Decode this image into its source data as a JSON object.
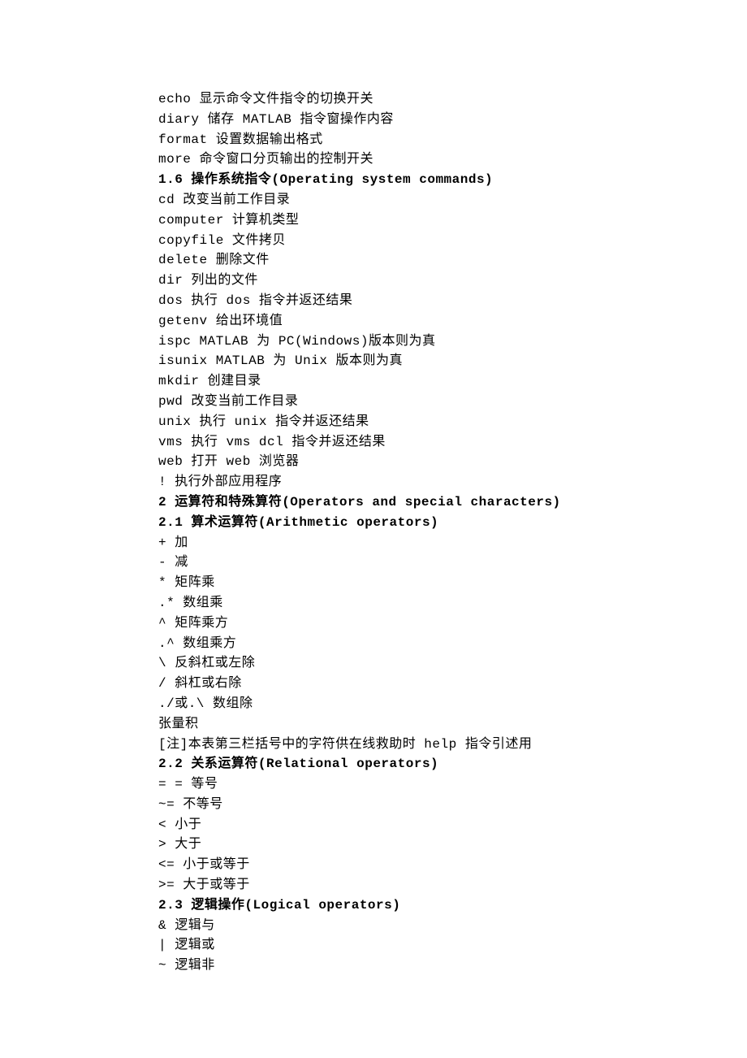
{
  "lines": [
    {
      "text": "echo 显示命令文件指令的切换开关",
      "heading": false
    },
    {
      "text": "diary 储存 MATLAB 指令窗操作内容",
      "heading": false
    },
    {
      "text": "format 设置数据输出格式",
      "heading": false
    },
    {
      "text": "more 命令窗口分页输出的控制开关",
      "heading": false
    },
    {
      "text": "1.6 操作系统指令(Operating system commands)",
      "heading": true
    },
    {
      "text": "cd 改变当前工作目录",
      "heading": false
    },
    {
      "text": "computer 计算机类型",
      "heading": false
    },
    {
      "text": "copyfile 文件拷贝",
      "heading": false
    },
    {
      "text": "delete 删除文件",
      "heading": false
    },
    {
      "text": "dir 列出的文件",
      "heading": false
    },
    {
      "text": "dos 执行 dos 指令并返还结果",
      "heading": false
    },
    {
      "text": "getenv 给出环境值",
      "heading": false
    },
    {
      "text": "ispc MATLAB 为 PC(Windows)版本则为真",
      "heading": false
    },
    {
      "text": "isunix MATLAB 为 Unix 版本则为真",
      "heading": false
    },
    {
      "text": "mkdir 创建目录",
      "heading": false
    },
    {
      "text": "pwd 改变当前工作目录",
      "heading": false
    },
    {
      "text": "unix 执行 unix 指令并返还结果",
      "heading": false
    },
    {
      "text": "vms 执行 vms dcl 指令并返还结果",
      "heading": false
    },
    {
      "text": "web 打开 web 浏览器",
      "heading": false
    },
    {
      "text": "! 执行外部应用程序",
      "heading": false
    },
    {
      "text": "2 运算符和特殊算符(Operators and special characters)",
      "heading": true
    },
    {
      "text": "2.1 算术运算符(Arithmetic operators)",
      "heading": true
    },
    {
      "text": "+ 加",
      "heading": false
    },
    {
      "text": "- 减",
      "heading": false
    },
    {
      "text": "* 矩阵乘",
      "heading": false
    },
    {
      "text": ".* 数组乘",
      "heading": false
    },
    {
      "text": "^ 矩阵乘方",
      "heading": false
    },
    {
      "text": ".^ 数组乘方",
      "heading": false
    },
    {
      "text": "\\ 反斜杠或左除",
      "heading": false
    },
    {
      "text": "/ 斜杠或右除",
      "heading": false
    },
    {
      "text": "./或.\\ 数组除",
      "heading": false
    },
    {
      "text": "张量积",
      "heading": false
    },
    {
      "text": "[注]本表第三栏括号中的字符供在线救助时 help 指令引述用",
      "heading": false
    },
    {
      "text": "2.2 关系运算符(Relational operators)",
      "heading": true
    },
    {
      "text": "= = 等号",
      "heading": false
    },
    {
      "text": "~= 不等号",
      "heading": false
    },
    {
      "text": "< 小于",
      "heading": false
    },
    {
      "text": "> 大于",
      "heading": false
    },
    {
      "text": "<= 小于或等于",
      "heading": false
    },
    {
      "text": ">= 大于或等于",
      "heading": false
    },
    {
      "text": "2.3 逻辑操作(Logical operators)",
      "heading": true
    },
    {
      "text": "& 逻辑与",
      "heading": false
    },
    {
      "text": "| 逻辑或",
      "heading": false
    },
    {
      "text": "~ 逻辑非",
      "heading": false
    }
  ]
}
